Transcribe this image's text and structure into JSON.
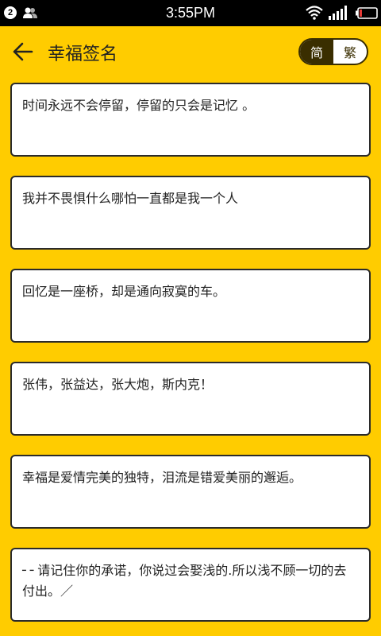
{
  "status_bar": {
    "notification_count": "2",
    "time": "3:55PM",
    "icons": [
      "users-icon",
      "wifi-icon",
      "signal-icon",
      "battery-icon"
    ]
  },
  "header": {
    "title": "幸福签名",
    "back_icon": "arrow-left-icon",
    "toggle": {
      "simplified": "简",
      "traditional": "繁",
      "selected": "简"
    }
  },
  "cards": [
    "时间永远不会停留，停留的只会是记忆 。",
    "我并不畏惧什么哪怕一直都是我一个人",
    "回忆是一座桥，却是通向寂寞的车。",
    "张伟，张益达，张大炮，斯内克！",
    "幸福是爱情完美的独特，泪流是错爱美丽的邂逅。",
    "╴╴请记住你的承诺，你说过会娶浅的.所以浅不顾一切的去付出。／"
  ],
  "colors": {
    "background": "#FFCC00",
    "status_bar": "#000000",
    "toggle_active": "#3a2e00",
    "card": "#FFFFFF"
  }
}
